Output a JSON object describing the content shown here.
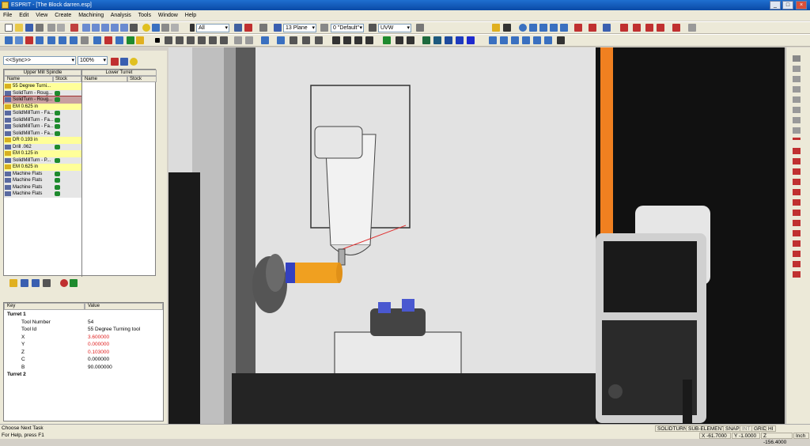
{
  "title": "ESPRIT - [The Block darren.esp]",
  "menu": [
    "File",
    "Edit",
    "View",
    "Create",
    "Machining",
    "Analysis",
    "Tools",
    "Window",
    "Help"
  ],
  "toolbar": {
    "filter_value": "All",
    "plane_value": "13 Plane",
    "layer_value": "0 \"Default\"",
    "coord_value": "UVW"
  },
  "sync": {
    "value": "<<Sync>>",
    "zoom": "100%"
  },
  "grid": {
    "upper_header": "Upper Mill Spindle",
    "lower_header": "Lower Turret",
    "col_name": "Name",
    "col_stock": "Stock",
    "rows": [
      {
        "name": "55 Degree Turni...",
        "stock": false,
        "style": "yellow"
      },
      {
        "name": "SolidTurn - Roug...",
        "stock": true,
        "style": "grey"
      },
      {
        "name": "SolidTurn - Roug...",
        "stock": true,
        "style": "selected"
      },
      {
        "name": "EM 0.625 in",
        "stock": false,
        "style": "yellow"
      },
      {
        "name": "SolidMillTurn - Fa...",
        "stock": true,
        "style": "grey"
      },
      {
        "name": "SolidMillTurn - Fa...",
        "stock": true,
        "style": "grey"
      },
      {
        "name": "SolidMillTurn - Fa...",
        "stock": true,
        "style": "grey"
      },
      {
        "name": "SolidMillTurn - Fa...",
        "stock": true,
        "style": "grey"
      },
      {
        "name": "DR 0.193 in",
        "stock": false,
        "style": "yellow"
      },
      {
        "name": "Drill .062",
        "stock": true,
        "style": "grey"
      },
      {
        "name": "EM 0.125 in",
        "stock": false,
        "style": "yellow"
      },
      {
        "name": "SolidMillTurn - P...",
        "stock": true,
        "style": "grey"
      },
      {
        "name": "EM 0.625 in",
        "stock": false,
        "style": "yellow"
      },
      {
        "name": "Machine Flats",
        "stock": true,
        "style": "grey"
      },
      {
        "name": "Machine Flats",
        "stock": true,
        "style": "grey"
      },
      {
        "name": "Machine Flats",
        "stock": true,
        "style": "grey"
      },
      {
        "name": "Machine Flats",
        "stock": true,
        "style": "grey"
      }
    ]
  },
  "props": {
    "col_key": "Key",
    "col_value": "Value",
    "rows": [
      {
        "key": "Turret 1",
        "value": "",
        "group": true
      },
      {
        "key": "Tool Number",
        "value": "54"
      },
      {
        "key": "Tool Id",
        "value": "55 Degree Turning tool"
      },
      {
        "key": "X",
        "value": "3.600000",
        "red": true
      },
      {
        "key": "Y",
        "value": "0.000000",
        "red": true
      },
      {
        "key": "Z",
        "value": "0.103000",
        "red": true
      },
      {
        "key": "C",
        "value": "0.000000"
      },
      {
        "key": "B",
        "value": "90.000000"
      },
      {
        "key": "Turret 2",
        "value": "",
        "group": true
      }
    ]
  },
  "status": {
    "line1": "Choose Next Task",
    "line2": "For Help, press F1",
    "modes": [
      "SOLIDTURN",
      "SUB-ELEMENTS",
      "SNAP",
      "INT",
      "GRID",
      "HI"
    ],
    "x": "X -61.7000",
    "y": "Y -1.0000",
    "z": "Z -156.4000",
    "units": "Inch"
  },
  "colors": {
    "accent_orange": "#f08020",
    "stock_green": "#1e8a2e",
    "tool_blue": "#3340c0",
    "titlebar": "#0a4aa6"
  }
}
